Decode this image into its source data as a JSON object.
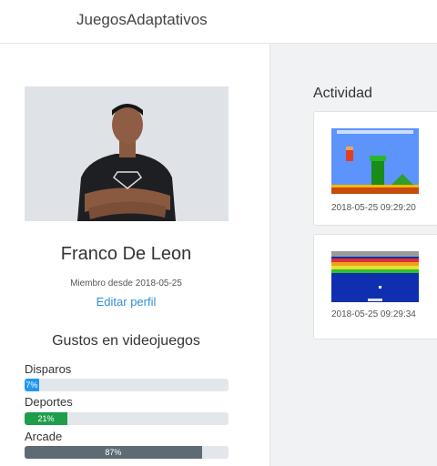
{
  "navbar": {
    "brand": "JuegosAdaptativos"
  },
  "profile": {
    "name": "Franco De Leon",
    "member_since": "Miembro desde 2018-05-25",
    "edit_label": "Editar perfil",
    "prefs_title": "Gustos en videojuegos",
    "prefs": [
      {
        "label": "Disparos",
        "percent": 7,
        "percent_text": "7%",
        "color": "#2196f3"
      },
      {
        "label": "Deportes",
        "percent": 21,
        "percent_text": "21%",
        "color": "#1e9e4a"
      },
      {
        "label": "Arcade",
        "percent": 87,
        "percent_text": "87%",
        "color": "#5f6b72"
      }
    ]
  },
  "activity": {
    "title": "Actividad",
    "items": [
      {
        "game_icon": "platformer-game-thumbnail",
        "date": "2018-05-25 09:29:20"
      },
      {
        "game_icon": "breakout-game-thumbnail",
        "date": "2018-05-25 09:29:34"
      }
    ]
  }
}
